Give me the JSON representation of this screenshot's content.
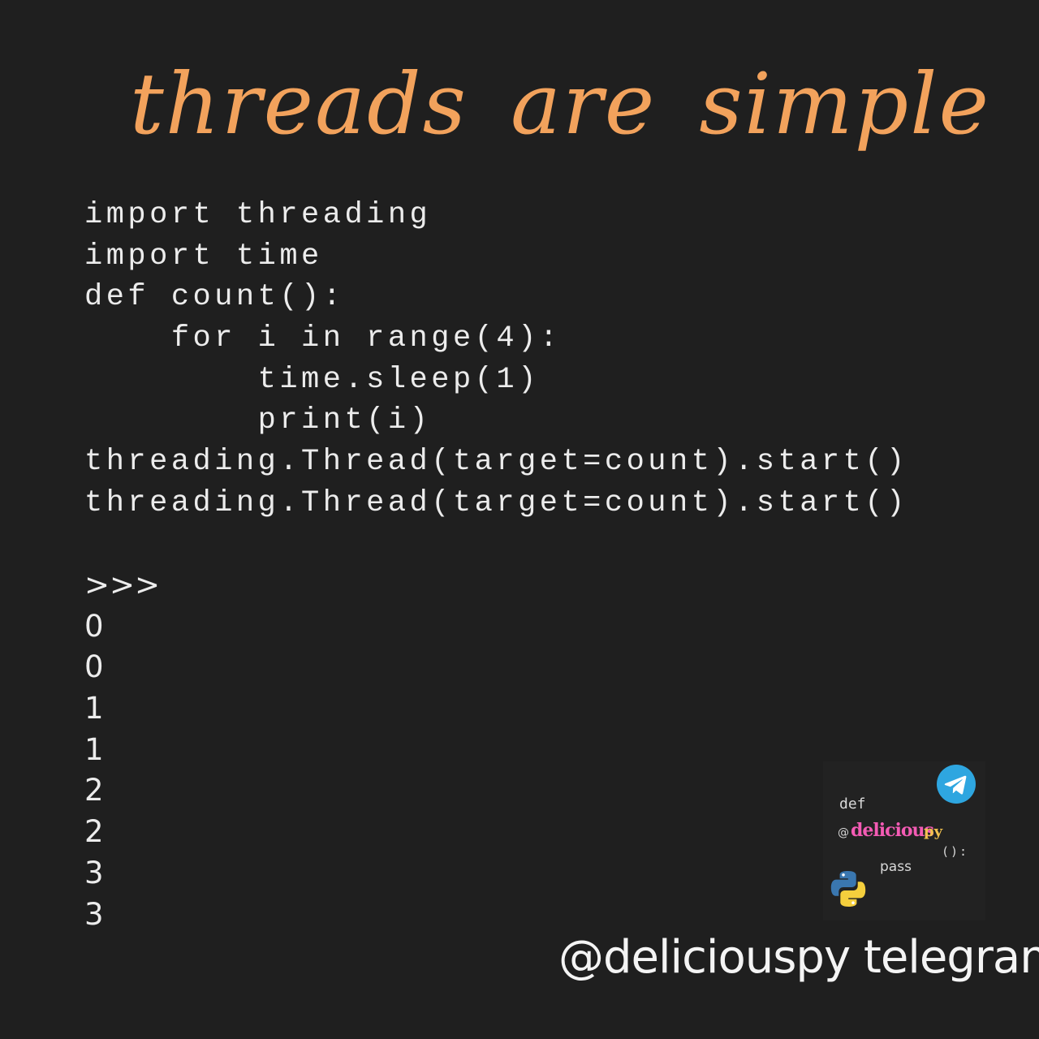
{
  "title": "threads are simple",
  "code_lines": [
    "import threading",
    "import time",
    "def count():",
    "    for i in range(4):",
    "        time.sleep(1)",
    "        print(i)",
    "threading.Thread(target=count).start()",
    "threading.Thread(target=count).start()"
  ],
  "output_lines": [
    ">>>",
    "0",
    "0",
    "1",
    "1",
    "2",
    "2",
    "3",
    "3"
  ],
  "badge": {
    "def": "def",
    "at": "@",
    "name": "delicious",
    "suffix": "py",
    "parens": "():",
    "pass": "pass",
    "icons": [
      "telegram-icon",
      "python-logo-icon"
    ]
  },
  "handle": "@deliciouspy telegram",
  "colors": {
    "background": "#1f1f1f",
    "title": "#f2a25c",
    "code": "#ececec",
    "brand_pink": "#f45bb4",
    "telegram_blue": "#2ea6e0"
  }
}
